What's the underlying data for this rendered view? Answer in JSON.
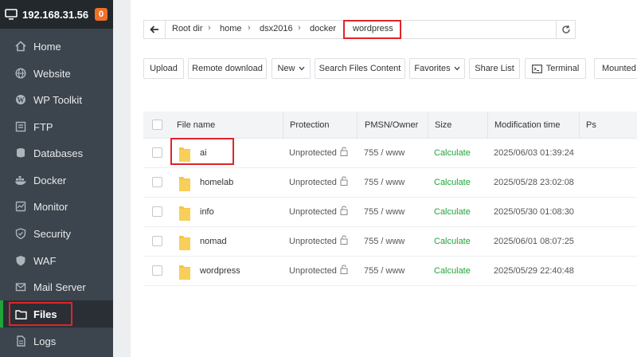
{
  "sidebar": {
    "ip": "192.168.31.56",
    "badge": "0",
    "items": [
      {
        "label": "Home",
        "icon": "home-icon"
      },
      {
        "label": "Website",
        "icon": "globe-icon"
      },
      {
        "label": "WP Toolkit",
        "icon": "wordpress-icon"
      },
      {
        "label": "FTP",
        "icon": "ftp-icon"
      },
      {
        "label": "Databases",
        "icon": "database-icon"
      },
      {
        "label": "Docker",
        "icon": "docker-icon"
      },
      {
        "label": "Monitor",
        "icon": "monitor-icon"
      },
      {
        "label": "Security",
        "icon": "shield-icon"
      },
      {
        "label": "WAF",
        "icon": "waf-shield-icon"
      },
      {
        "label": "Mail Server",
        "icon": "mail-icon"
      },
      {
        "label": "Files",
        "icon": "folder-icon",
        "active": true
      },
      {
        "label": "Logs",
        "icon": "log-file-icon"
      }
    ]
  },
  "breadcrumb": [
    "Root dir",
    "home",
    "dsx2016",
    "docker",
    "wordpress"
  ],
  "toolbar": {
    "upload": "Upload",
    "remote_download": "Remote download",
    "new": "New",
    "search": "Search Files Content",
    "favorites": "Favorites",
    "share_list": "Share List",
    "terminal": "Terminal",
    "mounted": "Mounted"
  },
  "table": {
    "headers": [
      "File name",
      "Protection",
      "PMSN/Owner",
      "Size",
      "Modification time",
      "Ps"
    ],
    "rows": [
      {
        "name": "ai",
        "protection": "Unprotected",
        "pmsn": "755 / www",
        "size": "Calculate",
        "mtime": "2025/06/03 01:39:24"
      },
      {
        "name": "homelab",
        "protection": "Unprotected",
        "pmsn": "755 / www",
        "size": "Calculate",
        "mtime": "2025/05/28 23:02:08"
      },
      {
        "name": "info",
        "protection": "Unprotected",
        "pmsn": "755 / www",
        "size": "Calculate",
        "mtime": "2025/05/30 01:08:30"
      },
      {
        "name": "nomad",
        "protection": "Unprotected",
        "pmsn": "755 / www",
        "size": "Calculate",
        "mtime": "2025/06/01 08:07:25"
      },
      {
        "name": "wordpress",
        "protection": "Unprotected",
        "pmsn": "755 / www",
        "size": "Calculate",
        "mtime": "2025/05/29 22:40:48"
      }
    ]
  },
  "colors": {
    "sidebar_bg": "#3c444d",
    "accent_green": "#20a53a",
    "highlight_red": "#e0242a",
    "badge_orange": "#f0702a",
    "folder_yellow": "#f5c542"
  }
}
